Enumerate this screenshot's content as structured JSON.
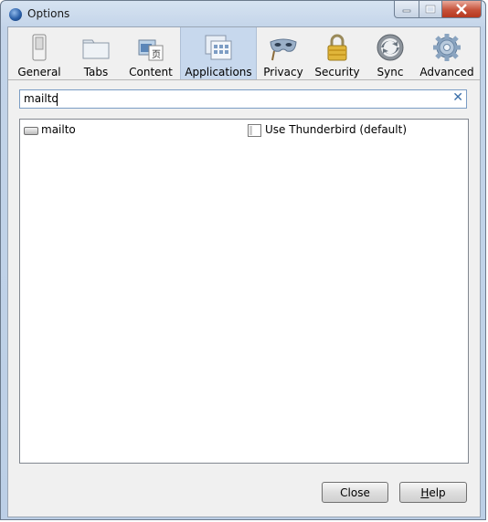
{
  "window": {
    "title": "Options"
  },
  "toolbar": {
    "tabs": [
      {
        "label": "General",
        "icon": "switch-icon"
      },
      {
        "label": "Tabs",
        "icon": "tabs-icon"
      },
      {
        "label": "Content",
        "icon": "content-icon"
      },
      {
        "label": "Applications",
        "icon": "applications-icon",
        "selected": true
      },
      {
        "label": "Privacy",
        "icon": "mask-icon"
      },
      {
        "label": "Security",
        "icon": "padlock-icon"
      },
      {
        "label": "Sync",
        "icon": "sync-icon"
      },
      {
        "label": "Advanced",
        "icon": "gear-icon"
      }
    ]
  },
  "search": {
    "value": "mailto"
  },
  "applications": {
    "rows": [
      {
        "content_type": "mailto",
        "action": "Use Thunderbird (default)"
      }
    ]
  },
  "buttons": {
    "close": "Close",
    "help_prefix": "H",
    "help_rest": "elp"
  },
  "colors": {
    "selected_tab": "#c7d8ed",
    "close_button": "#c6523a"
  }
}
